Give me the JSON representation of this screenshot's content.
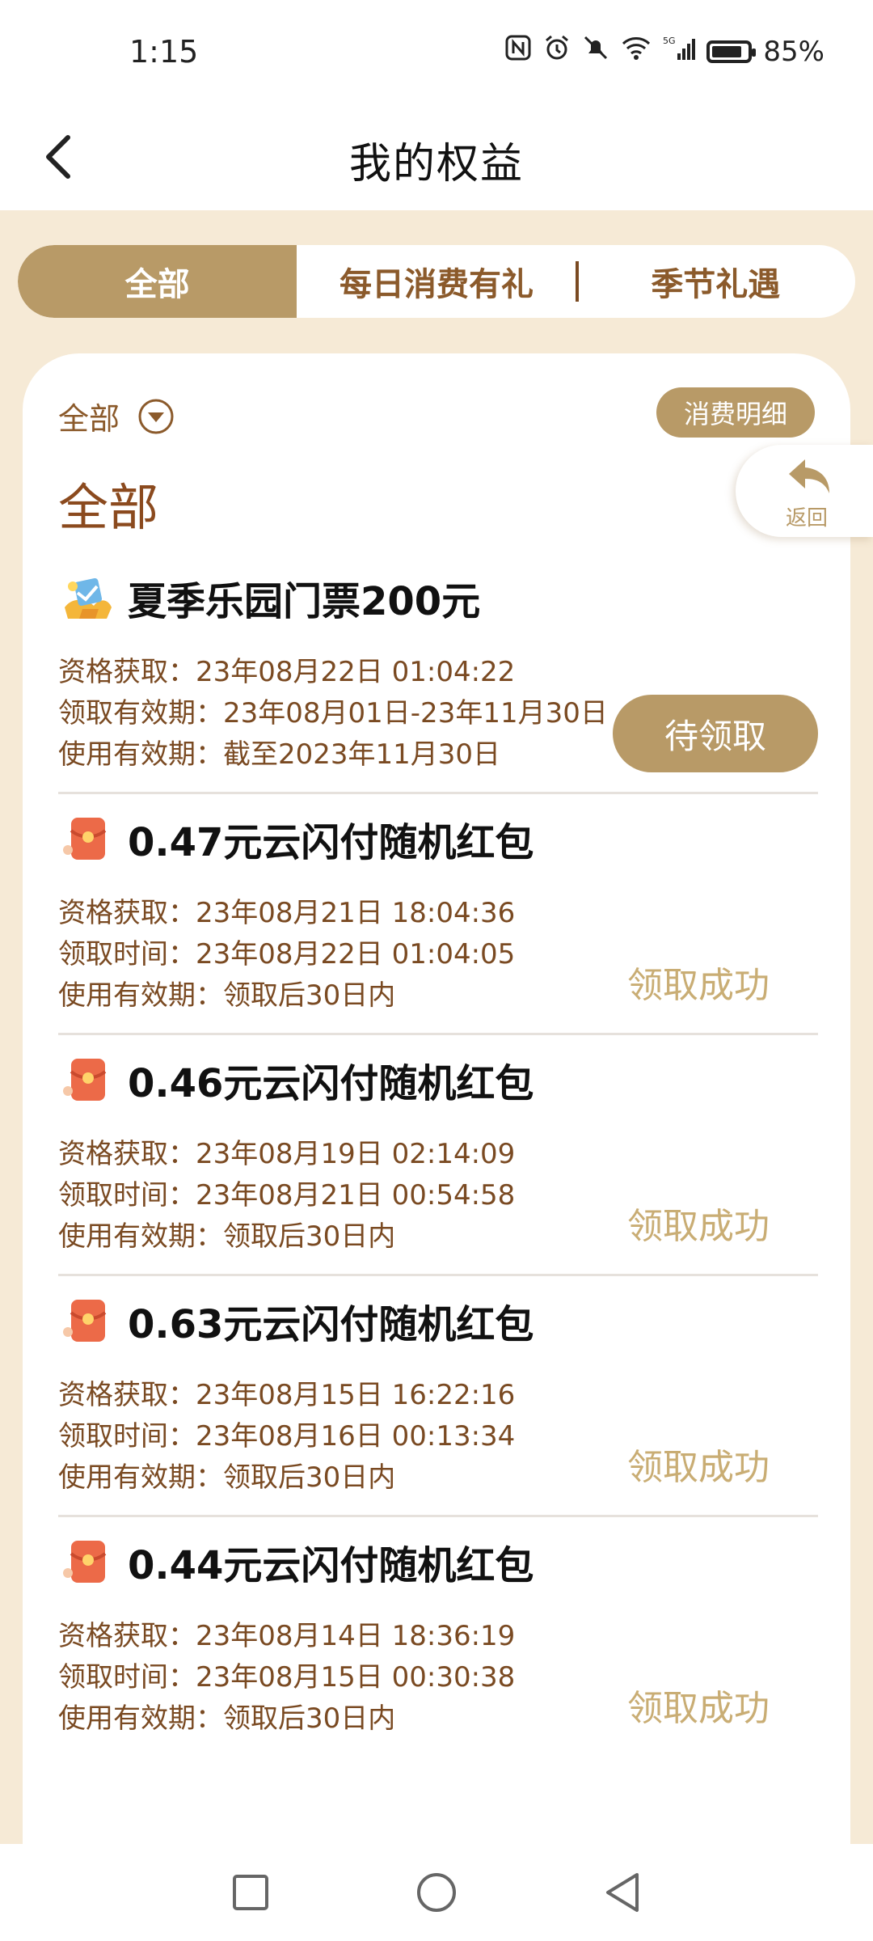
{
  "status_bar": {
    "time": "1:15",
    "battery": "85%",
    "battery_level": 0.85,
    "icons": [
      "nfc-icon",
      "alarm-icon",
      "mute-icon",
      "wifi-icon",
      "signal-5g-icon",
      "battery-icon"
    ]
  },
  "header": {
    "title": "我的权益",
    "back_icon": "chevron-left-icon"
  },
  "tabs": [
    {
      "label": "全部",
      "active": true
    },
    {
      "label": "每日消费有礼",
      "active": false
    },
    {
      "label": "季节礼遇",
      "active": false
    }
  ],
  "filter": {
    "label": "全部",
    "icon": "dropdown-circle-icon"
  },
  "detail_button": "消费明细",
  "section_title": "全部",
  "return_button": {
    "label": "返回",
    "icon": "reply-arrow-icon"
  },
  "items": [
    {
      "icon": "ticket-gift-icon",
      "title": "夏季乐园门票200元",
      "lines": [
        "资格获取：23年08月22日 01:04:22",
        "领取有效期：23年08月01日-23年11月30日",
        "使用有效期：截至2023年11月30日"
      ],
      "action_label": "待领取",
      "action_type": "button"
    },
    {
      "icon": "red-envelope-icon",
      "title": "0.47元云闪付随机红包",
      "lines": [
        "资格获取：23年08月21日 18:04:36",
        "领取时间：23年08月22日 01:04:05",
        "使用有效期：领取后30日内"
      ],
      "status_label": "领取成功",
      "action_type": "status"
    },
    {
      "icon": "red-envelope-icon",
      "title": "0.46元云闪付随机红包",
      "lines": [
        "资格获取：23年08月19日 02:14:09",
        "领取时间：23年08月21日 00:54:58",
        "使用有效期：领取后30日内"
      ],
      "status_label": "领取成功",
      "action_type": "status"
    },
    {
      "icon": "red-envelope-icon",
      "title": "0.63元云闪付随机红包",
      "lines": [
        "资格获取：23年08月15日 16:22:16",
        "领取时间：23年08月16日 00:13:34",
        "使用有效期：领取后30日内"
      ],
      "status_label": "领取成功",
      "action_type": "status"
    },
    {
      "icon": "red-envelope-icon",
      "title": "0.44元云闪付随机红包",
      "lines": [
        "资格获取：23年08月14日 18:36:19",
        "领取时间：23年08月15日 00:30:38",
        "使用有效期：领取后30日内"
      ],
      "status_label": "领取成功",
      "action_type": "status"
    }
  ],
  "nav_bar": {
    "icons": [
      "recents-square-icon",
      "home-circle-icon",
      "back-triangle-icon"
    ]
  },
  "colors": {
    "accent_gold": "#b89a67",
    "brown_text": "#7a4a22",
    "title_brown": "#8b4a1e",
    "page_bg": "#f6ead6",
    "success_text": "#c9ad74"
  }
}
